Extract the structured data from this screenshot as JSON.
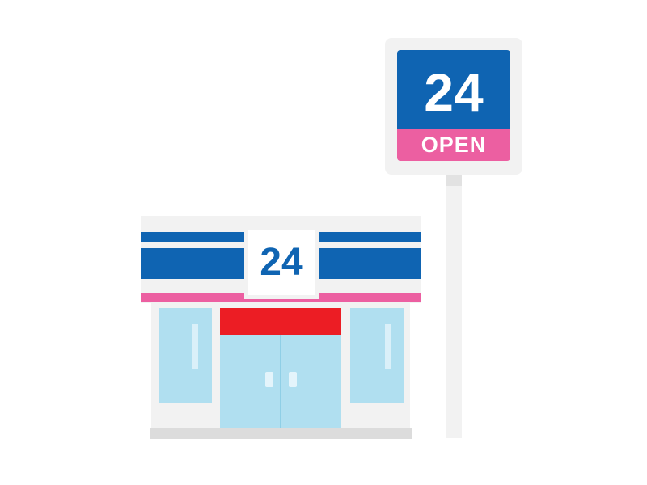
{
  "sign": {
    "number": "24",
    "status": "OPEN"
  },
  "store": {
    "number": "24"
  },
  "colors": {
    "brand_blue": "#0f64b2",
    "accent_pink": "#ec5fa1",
    "awning_red": "#ec1d24",
    "glass": "#b0dff0",
    "wall": "#f2f2f2"
  }
}
